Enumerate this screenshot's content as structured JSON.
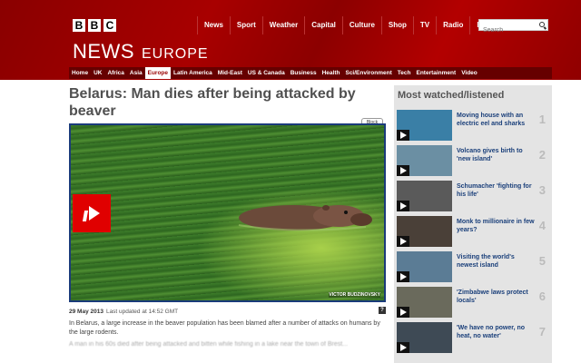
{
  "header": {
    "logo": [
      "B",
      "B",
      "C"
    ],
    "nav": [
      "News",
      "Sport",
      "Weather",
      "Capital",
      "Culture",
      "Shop",
      "TV",
      "Radio",
      "More..."
    ],
    "search_placeholder": "Search",
    "section_title": "NEWS",
    "section_sub": "EUROPE",
    "brand_color": "#990000"
  },
  "subnav": [
    "Home",
    "UK",
    "Africa",
    "Asia",
    "Europe",
    "Latin America",
    "Mid-East",
    "US & Canada",
    "Business",
    "Health",
    "Sci/Environment",
    "Tech",
    "Entertainment",
    "Video"
  ],
  "subnav_active": "Europe",
  "article": {
    "headline": "Belarus: Man dies after being attacked by beaver",
    "video_credit": "VICTOR BUDZINOVSKY",
    "block_tag": "Block",
    "date": "29 May 2013",
    "updated": "Last updated at 14:52 GMT",
    "help_icon": "?",
    "para1": "In Belarus, a large increase in the beaver population has been blamed after a number of attacks on humans by the large rodents.",
    "para2": "A man in his 60s died after being attacked and bitten while fishing in a lake near the town of Brest..."
  },
  "sidebar": {
    "title": "Most watched/listened",
    "items": [
      {
        "text": "Moving house with an electric eel and sharks",
        "num": "1",
        "thumb": "#3a7fa6"
      },
      {
        "text": "Volcano gives birth to 'new island'",
        "num": "2",
        "thumb": "#6b8fa3"
      },
      {
        "text": "Schumacher 'fighting for his life'",
        "num": "3",
        "thumb": "#5a5a5a"
      },
      {
        "text": "Monk to millionaire in few years?",
        "num": "4",
        "thumb": "#4a4038"
      },
      {
        "text": "Visiting the world's newest island",
        "num": "5",
        "thumb": "#5b7c95"
      },
      {
        "text": "'Zimbabwe laws protect locals'",
        "num": "6",
        "thumb": "#6a6a5c"
      },
      {
        "text": "'We have no power, no heat, no water'",
        "num": "7",
        "thumb": "#3e4a55"
      }
    ]
  }
}
